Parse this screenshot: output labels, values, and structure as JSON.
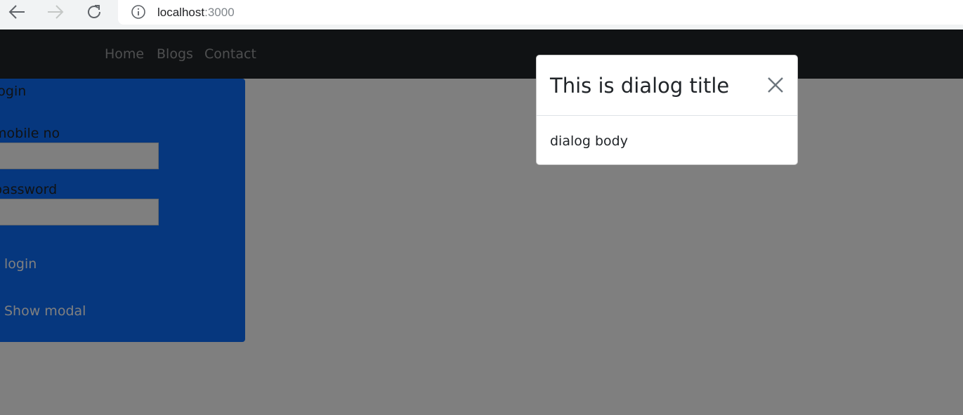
{
  "browser": {
    "url_host": "localhost",
    "url_port": ":3000"
  },
  "navbar": {
    "links": [
      {
        "label": "Home"
      },
      {
        "label": "Blogs"
      },
      {
        "label": "Contact"
      }
    ]
  },
  "login_panel": {
    "heading": "login",
    "mobile_label": "mobile no",
    "mobile_value": "",
    "password_label": "password",
    "password_value": "",
    "login_button": "login",
    "show_modal_button": "Show modal"
  },
  "modal": {
    "title": "This is dialog title",
    "body": "dialog body"
  }
}
